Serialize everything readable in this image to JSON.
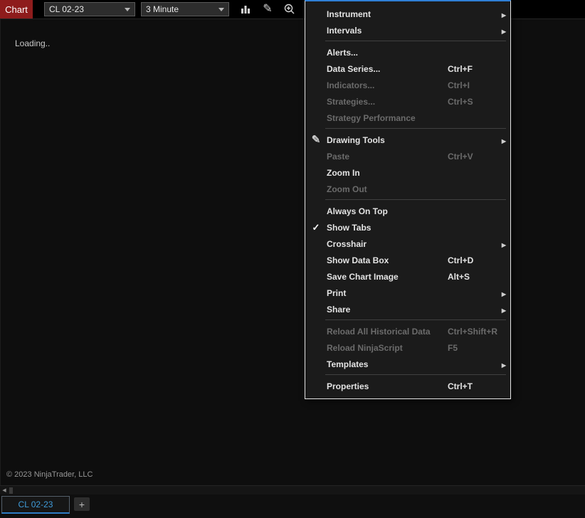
{
  "window": {
    "title_tab": "Chart",
    "copyright": "© 2023 NinjaTrader, LLC"
  },
  "toolbar": {
    "instrument_value": "CL 02-23",
    "interval_value": "3 Minute",
    "icons": [
      "bar-type-icon",
      "drawing-tools-icon",
      "zoom-in-icon",
      "zoom-out-icon"
    ]
  },
  "chart": {
    "loading_text": "Loading.."
  },
  "context_menu": {
    "items": [
      {
        "label": "Instrument",
        "submenu": true
      },
      {
        "label": "Intervals",
        "submenu": true
      },
      {
        "separator": true
      },
      {
        "label": "Alerts..."
      },
      {
        "label": "Data Series...",
        "shortcut": "Ctrl+F"
      },
      {
        "label": "Indicators...",
        "shortcut": "Ctrl+I",
        "disabled": true
      },
      {
        "label": "Strategies...",
        "shortcut": "Ctrl+S",
        "disabled": true
      },
      {
        "label": "Strategy Performance",
        "disabled": true
      },
      {
        "separator": true
      },
      {
        "label": "Drawing Tools",
        "submenu": true,
        "icon": "pencil-icon"
      },
      {
        "label": "Paste",
        "shortcut": "Ctrl+V",
        "disabled": true
      },
      {
        "label": "Zoom In"
      },
      {
        "label": "Zoom Out",
        "disabled": true
      },
      {
        "separator": true
      },
      {
        "label": "Always On Top"
      },
      {
        "label": "Show Tabs",
        "checked": true
      },
      {
        "label": "Crosshair",
        "submenu": true
      },
      {
        "label": "Show Data Box",
        "shortcut": "Ctrl+D"
      },
      {
        "label": "Save Chart Image",
        "shortcut": "Alt+S"
      },
      {
        "label": "Print",
        "submenu": true
      },
      {
        "label": "Share",
        "submenu": true
      },
      {
        "separator": true
      },
      {
        "label": "Reload All Historical Data",
        "shortcut": "Ctrl+Shift+R",
        "disabled": true
      },
      {
        "label": "Reload NinjaScript",
        "shortcut": "F5",
        "disabled": true
      },
      {
        "label": "Templates",
        "submenu": true
      },
      {
        "separator": true
      },
      {
        "label": "Properties",
        "shortcut": "Ctrl+T"
      }
    ]
  },
  "tab_bar": {
    "tab_label": "CL 02-23",
    "add_tab_label": "+"
  },
  "colors": {
    "accent_blue": "#2f7fd6",
    "title_red": "#8e1c1c",
    "menu_bg": "#1b1b1b",
    "tab_text_blue": "#3f9bd8"
  }
}
